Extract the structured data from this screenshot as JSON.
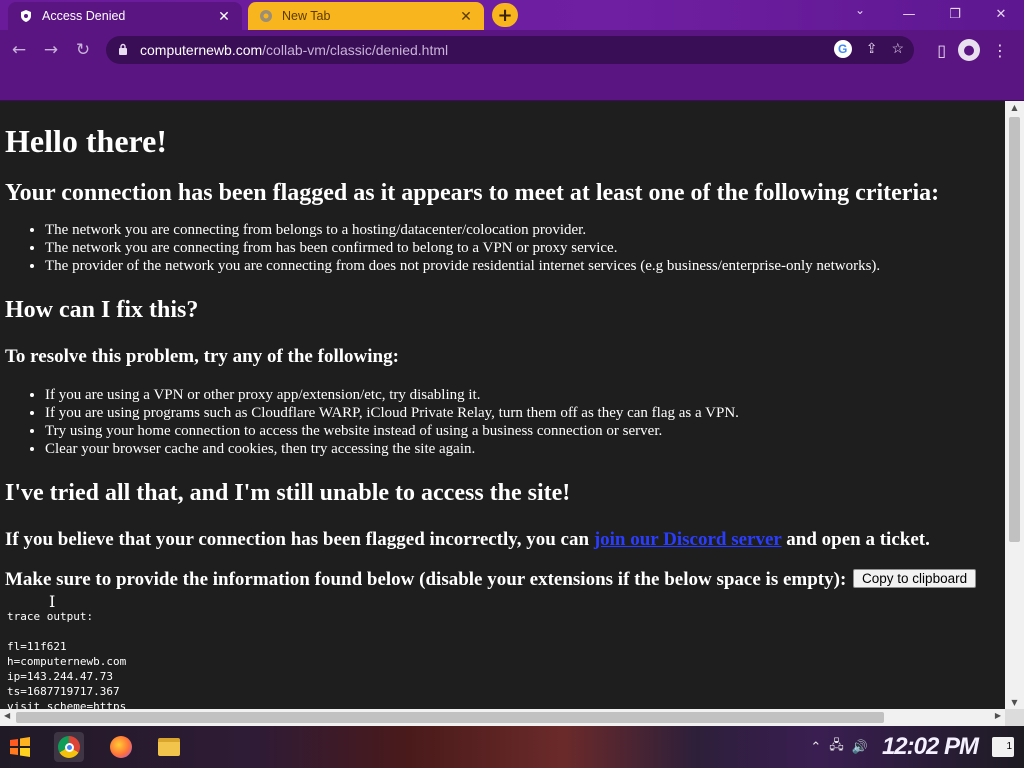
{
  "browser": {
    "tabs": [
      {
        "title": "Access Denied",
        "active": true,
        "favicon": "shield-favicon"
      },
      {
        "title": "New Tab",
        "active": false,
        "favicon": "chrome-favicon"
      }
    ],
    "new_tab": "+",
    "url_host": "computernewb.com",
    "url_path": "/collab-vm/classic/denied.html",
    "accent_color": "#5a1582",
    "tab_color_inactive": "#f9b51d"
  },
  "page": {
    "h1": "Hello there!",
    "h2_flagged": "Your connection has been flagged as it appears to meet at least one of the following criteria:",
    "criteria": [
      "The network you are connecting from belongs to a hosting/datacenter/colocation provider.",
      "The network you are connecting from has been confirmed to belong to a VPN or proxy service.",
      "The provider of the network you are connecting from does not provide residential internet services (e.g business/enterprise-only networks)."
    ],
    "h2_fix": "How can I fix this?",
    "h3_resolve": "To resolve this problem, try any of the following:",
    "fixes": [
      "If you are using a VPN or other proxy app/extension/etc, try disabling it.",
      "If you are using programs such as Cloudflare WARP, iCloud Private Relay, turn them off as they can flag as a VPN.",
      "Try using your home connection to access the website instead of using a business connection or server.",
      "Clear your browser cache and cookies, then try accessing the site again."
    ],
    "h2_tried": "I've tried all that, and I'm still unable to access the site!",
    "believe_pre": "If you believe that your connection has been flagged incorrectly, you can ",
    "believe_link": "join our Discord server",
    "believe_post": " and open a ticket.",
    "make_sure": "Make sure to provide the information found below (disable your extensions if the below space is empty):",
    "copy_button": "Copy to clipboard",
    "trace_title": "trace output:",
    "trace_lines": [
      "fl=11f621",
      "h=computernewb.com",
      "ip=143.244.47.73",
      "ts=1687719717.367",
      "visit_scheme=https"
    ]
  },
  "taskbar": {
    "clock": "12:02 PM",
    "notification_count": "1"
  }
}
